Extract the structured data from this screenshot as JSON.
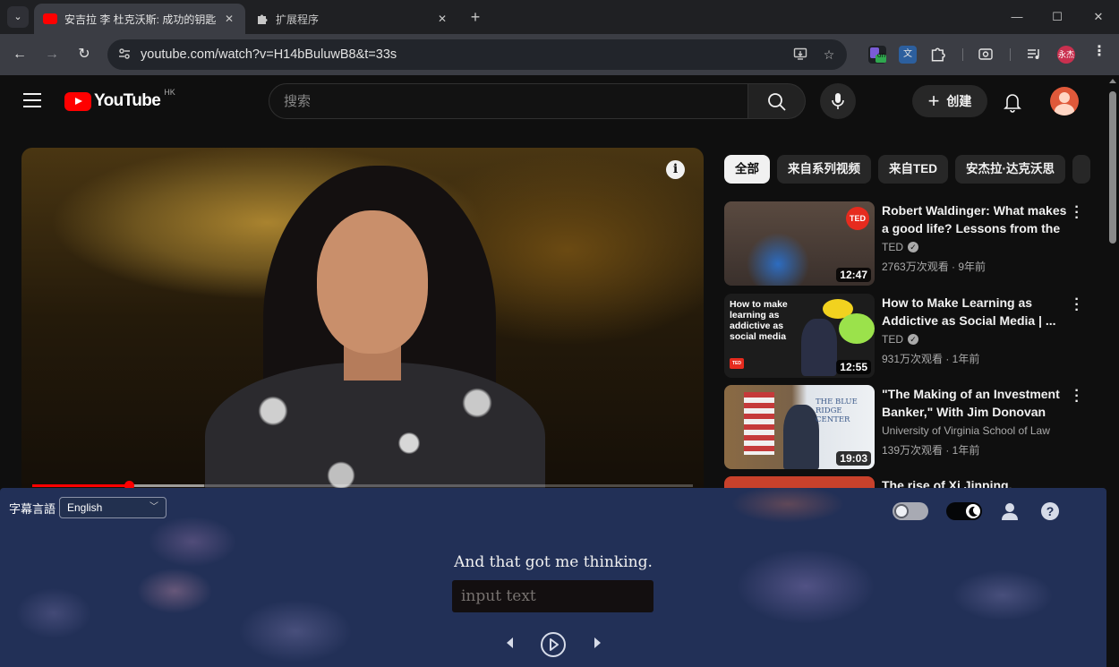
{
  "browser": {
    "tabs": [
      {
        "title": "安吉拉 李 杜克沃斯: 成功的钥匙",
        "active": true
      },
      {
        "title": "扩展程序",
        "active": false
      }
    ],
    "url": "youtube.com/watch?v=H14bBuluwB8&t=33s",
    "profile_badge": "永杰",
    "ext_badge": "on"
  },
  "youtube": {
    "logo_text": "YouTube",
    "region": "HK",
    "search_placeholder": "搜索",
    "create_label": "创建",
    "player": {
      "progress": 0.146,
      "loaded": 0.26,
      "info_glyph": "i"
    },
    "chips": [
      "全部",
      "来自系列视频",
      "来自TED",
      "安杰拉·达克沃思"
    ],
    "recommended": [
      {
        "title": "Robert Waldinger: What makes a good life? Lessons from the ...",
        "channel": "TED",
        "verified": true,
        "meta": "2763万次观看 · 9年前",
        "duration": "12:47",
        "thumb_badge": "TED"
      },
      {
        "title": "How to Make Learning as Addictive as Social Media | ...",
        "channel": "TED",
        "verified": true,
        "meta": "931万次观看 · 1年前",
        "duration": "12:55",
        "thumb_text": "How to make learning as addictive as social media",
        "thumb_badge": "TED"
      },
      {
        "title": "\"The Making of an Investment Banker,\" With Jim Donovan",
        "channel": "University of Virginia School of Law",
        "verified": false,
        "meta": "139万次观看 · 1年前",
        "duration": "19:03",
        "thumb_text": "THE BLUE RIDGE CENTER"
      },
      {
        "title": "The rise of Xi Jinping, explained",
        "channel": "",
        "verified": false,
        "meta": "",
        "duration": ""
      }
    ]
  },
  "subtitle_ext": {
    "language_label": "字幕言語",
    "language_value": "English",
    "current_line": "And that got me thinking.",
    "input_placeholder": "input text",
    "colors": {
      "panel": "#223057",
      "input_bg": "#130f10"
    }
  }
}
